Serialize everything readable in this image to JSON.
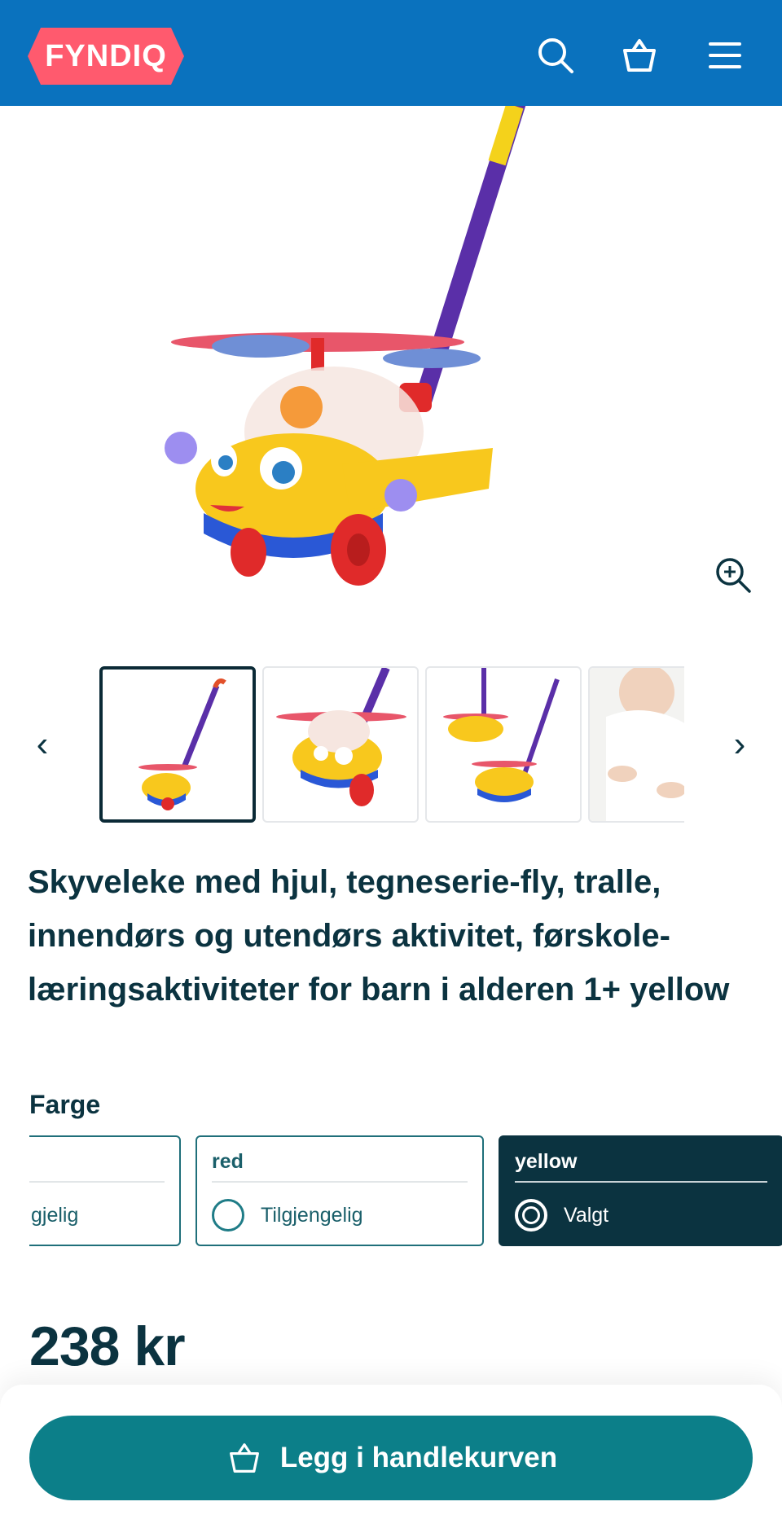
{
  "header": {
    "logo_text": "FYNDIQ",
    "icons": [
      "search-icon",
      "basket-icon",
      "menu-icon"
    ],
    "background_color": "#0a72be",
    "logo_color": "#ff5a6e"
  },
  "gallery": {
    "main_image": "yellow toy airplane push toy with purple handle",
    "zoom_icon": "zoom-in-icon",
    "prev_icon": "chevron-left-icon",
    "next_icon": "chevron-right-icon",
    "prev_glyph": "‹",
    "next_glyph": "›",
    "thumbnails": [
      {
        "label": "airplane push toy full view",
        "active": true
      },
      {
        "label": "airplane close-up",
        "active": false
      },
      {
        "label": "two airplanes",
        "active": false
      },
      {
        "label": "baby playing with toy",
        "active": false
      }
    ]
  },
  "product": {
    "title": "Skyveleke med hjul, tegneserie-fly, tralle, innendørs og utendørs aktivitet, førskole-læringsaktiviteter for barn i alderen 1+ yellow",
    "price": "238 kr"
  },
  "color_selector": {
    "label": "Farge",
    "options": [
      {
        "name": "",
        "status": "gjelig",
        "selected": false
      },
      {
        "name": "red",
        "status": "Tilgjengelig",
        "selected": false
      },
      {
        "name": "yellow",
        "status": "Valgt",
        "selected": true
      }
    ]
  },
  "cart": {
    "button_label": "Legg i handlekurven",
    "icon": "basket-icon",
    "button_color": "#0c7f89"
  }
}
